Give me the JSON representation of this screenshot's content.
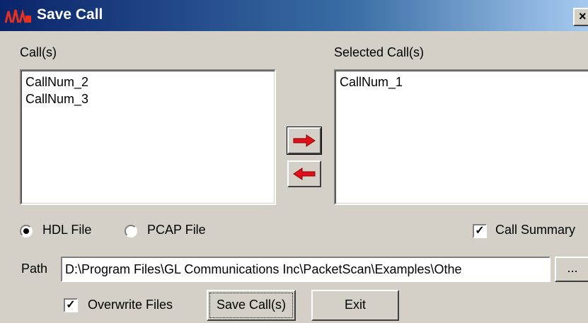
{
  "window": {
    "title": "Save Call",
    "close_glyph": "×",
    "icon": "app-logo-icon"
  },
  "calls_panel": {
    "label": "Call(s)",
    "items": [
      "CallNum_2",
      "CallNum_3"
    ]
  },
  "selected_panel": {
    "label": "Selected Call(s)",
    "items": [
      "CallNum_1"
    ]
  },
  "transfer": {
    "add_icon": "arrow-right-icon",
    "remove_icon": "arrow-left-icon",
    "arrow_color": "#e0101a"
  },
  "format": {
    "options": [
      {
        "label": "HDL File",
        "selected": true
      },
      {
        "label": "PCAP File",
        "selected": false
      }
    ]
  },
  "call_summary": {
    "label": "Call Summary",
    "checked": true,
    "mark": "✓"
  },
  "path": {
    "label": "Path",
    "value": "D:\\Program Files\\GL Communications Inc\\PacketScan\\Examples\\Othe",
    "browse_label": "..."
  },
  "overwrite": {
    "label": "Overwrite Files",
    "checked": true,
    "mark": "✓"
  },
  "buttons": {
    "save": "Save Call(s)",
    "exit": "Exit"
  },
  "colors": {
    "face": "#d4d0c8",
    "title_start": "#0a246a",
    "title_end": "#a6caf0"
  }
}
